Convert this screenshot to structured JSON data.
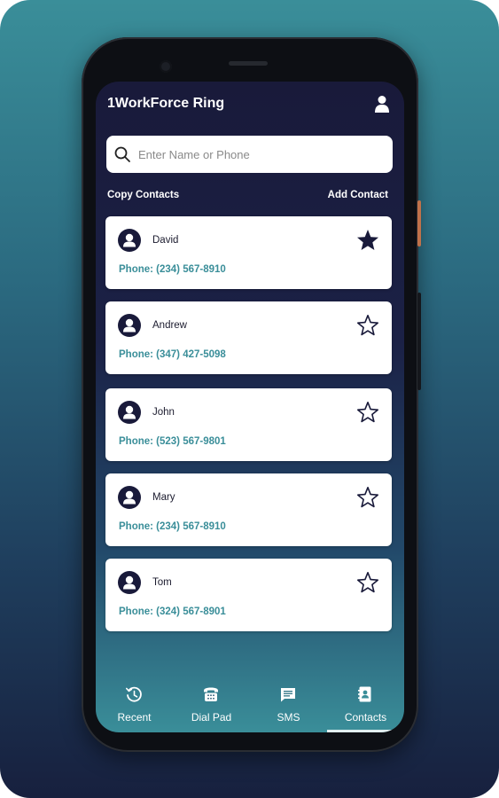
{
  "app": {
    "title": "1WorkForce Ring"
  },
  "search": {
    "placeholder": "Enter Name or Phone",
    "value": ""
  },
  "actions": {
    "copy_contacts": "Copy Contacts",
    "add_contact": "Add Contact"
  },
  "contacts": [
    {
      "name": "David",
      "phone": "Phone: (234) 567-8910",
      "favorite": true
    },
    {
      "name": "Andrew",
      "phone": "Phone: (347) 427-5098",
      "favorite": false
    },
    {
      "name": "John",
      "phone": "Phone: (523) 567-9801",
      "favorite": false
    },
    {
      "name": "Mary",
      "phone": "Phone: (234) 567-8910",
      "favorite": false
    },
    {
      "name": "Tom",
      "phone": "Phone: (324) 567-8901",
      "favorite": false
    }
  ],
  "nav": [
    {
      "label": "Recent",
      "icon": "history-icon"
    },
    {
      "label": "Dial Pad",
      "icon": "dialpad-icon"
    },
    {
      "label": "SMS",
      "icon": "message-icon"
    },
    {
      "label": "Contacts",
      "icon": "contacts-icon",
      "active": true
    }
  ],
  "colors": {
    "accent": "#3a8e99",
    "header": "#191a3a",
    "card": "#ffffff",
    "star": "#191a3a"
  }
}
